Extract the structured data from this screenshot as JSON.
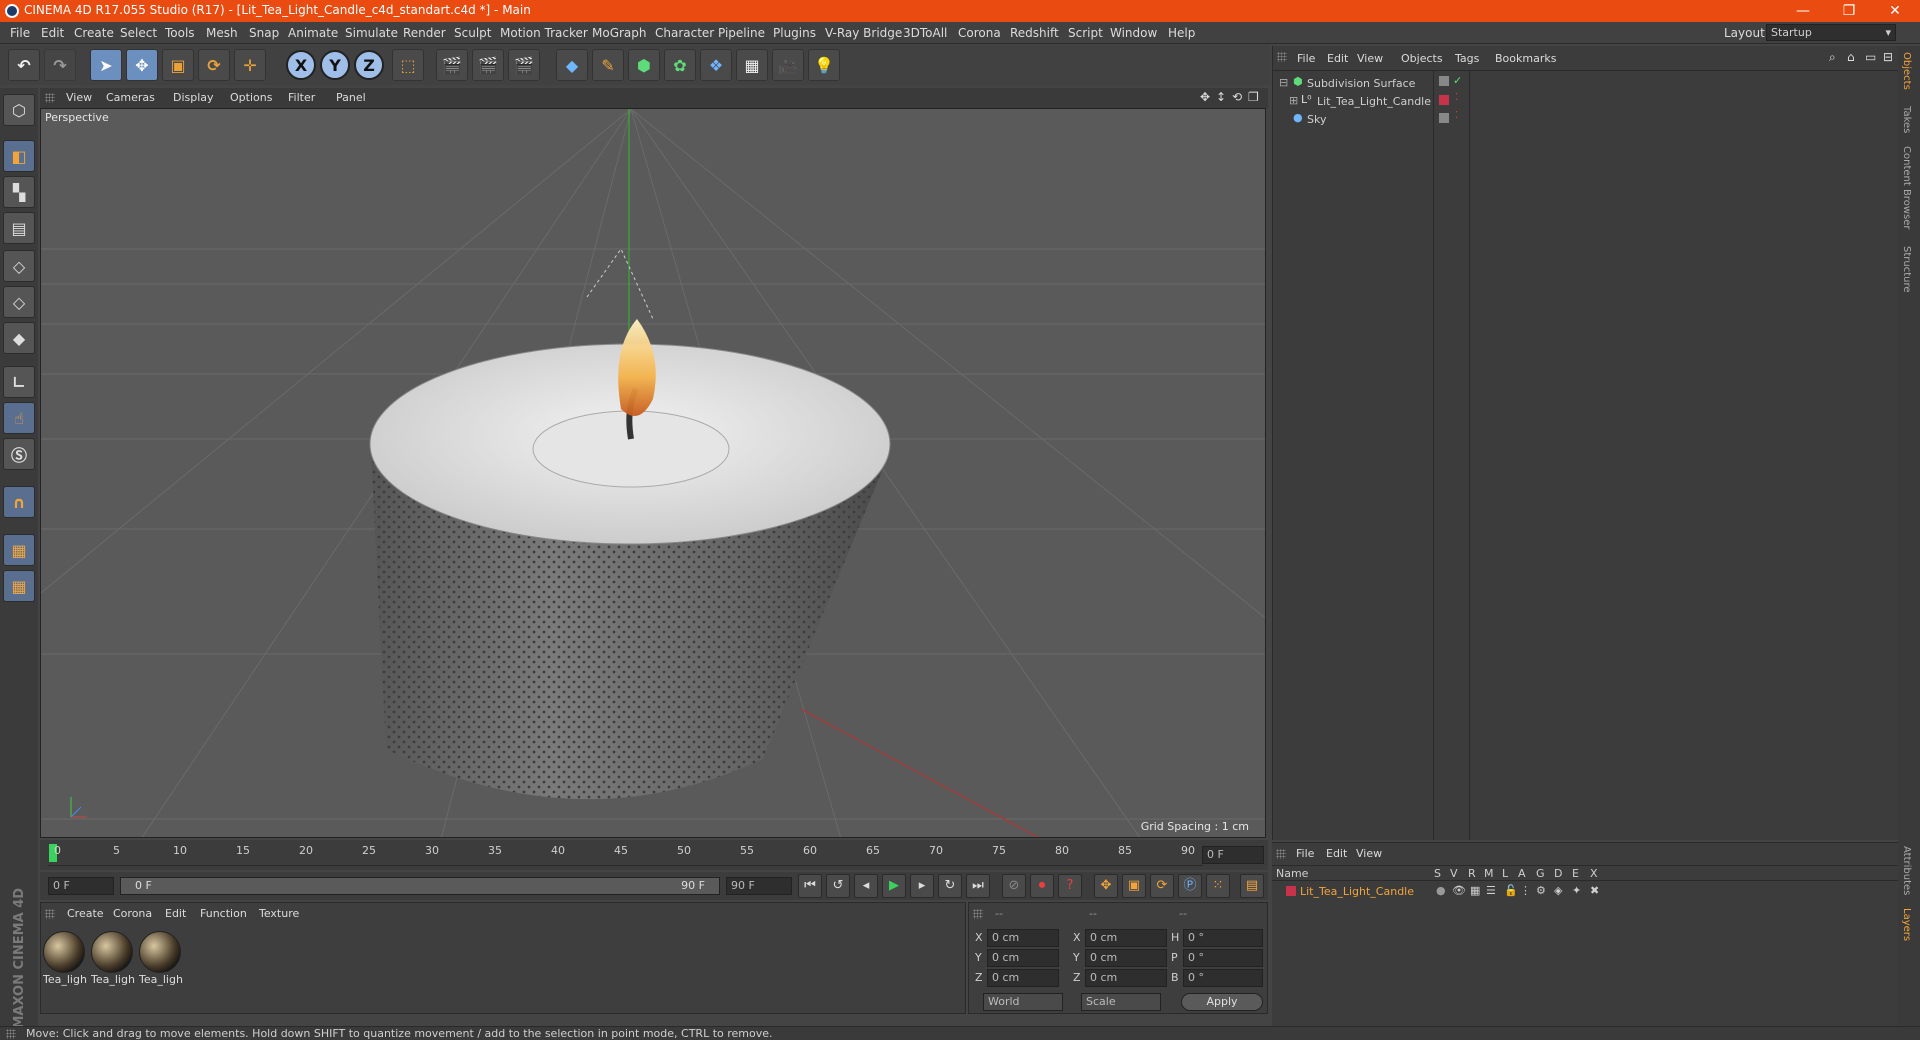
{
  "window": {
    "title": "CINEMA 4D R17.055 Studio (R17) - [Lit_Tea_Light_Candle_c4d_standart.c4d *] - Main",
    "minimize": "—",
    "restore": "❐",
    "close": "✕"
  },
  "menu": [
    "File",
    "Edit",
    "Create",
    "Select",
    "Tools",
    "Mesh",
    "Snap",
    "Animate",
    "Simulate",
    "Render",
    "Sculpt",
    "Motion Tracker",
    "MoGraph",
    "Character",
    "Pipeline",
    "Plugins",
    "V-Ray Bridge",
    "3DToAll",
    "Corona",
    "Redshift",
    "Script",
    "Window",
    "Help"
  ],
  "layout": {
    "label": "Layout:",
    "value": "Startup"
  },
  "viewport": {
    "menu": [
      "View",
      "Cameras",
      "Display",
      "Options",
      "Filter",
      "Panel"
    ],
    "label": "Perspective",
    "grid_spacing": "Grid Spacing : 1 cm"
  },
  "timeline": {
    "ticks": [
      "0",
      "5",
      "10",
      "15",
      "20",
      "25",
      "30",
      "35",
      "40",
      "45",
      "50",
      "55",
      "60",
      "65",
      "70",
      "75",
      "80",
      "85",
      "90"
    ],
    "current_frame": "0 F"
  },
  "playback": {
    "start": "0 F",
    "range_start": "0 F",
    "range_end": "90 F",
    "end": "90 F"
  },
  "materials": {
    "menu": [
      "Create",
      "Corona",
      "Edit",
      "Function",
      "Texture"
    ],
    "items": [
      "Tea_ligh",
      "Tea_ligh",
      "Tea_ligh"
    ],
    "brand": "MAXON CINEMA 4D"
  },
  "coordinates": {
    "headers": [
      "--",
      "--",
      "--"
    ],
    "rows": [
      {
        "a": "X",
        "av": "0 cm",
        "b": "X",
        "bv": "0 cm",
        "c": "H",
        "cv": "0 °"
      },
      {
        "a": "Y",
        "av": "0 cm",
        "b": "Y",
        "bv": "0 cm",
        "c": "P",
        "cv": "0 °"
      },
      {
        "a": "Z",
        "av": "0 cm",
        "b": "Z",
        "bv": "0 cm",
        "c": "B",
        "cv": "0 °"
      }
    ],
    "space": "World",
    "mode": "Scale",
    "apply": "Apply"
  },
  "objects": {
    "menu": [
      "File",
      "Edit",
      "View",
      "Objects",
      "Tags",
      "Bookmarks"
    ],
    "items": [
      "Subdivision Surface",
      "Lit_Tea_Light_Candle",
      "Sky"
    ]
  },
  "layers": {
    "menu": [
      "File",
      "Edit",
      "View"
    ],
    "columns": [
      "Name",
      "S",
      "V",
      "R",
      "M",
      "L",
      "A",
      "G",
      "D",
      "E",
      "X"
    ],
    "item": "Lit_Tea_Light_Candle"
  },
  "right_tabs": [
    "Objects",
    "Takes",
    "Content Browser",
    "Structure",
    "Attributes",
    "Layers"
  ],
  "status": "Move: Click and drag to move elements. Hold down SHIFT to quantize movement / add to the selection in point mode, CTRL to remove.",
  "colors": {
    "titlebar": "#ea4b10",
    "selection": "#6b8fbf",
    "layer_red": "#c8324a"
  }
}
